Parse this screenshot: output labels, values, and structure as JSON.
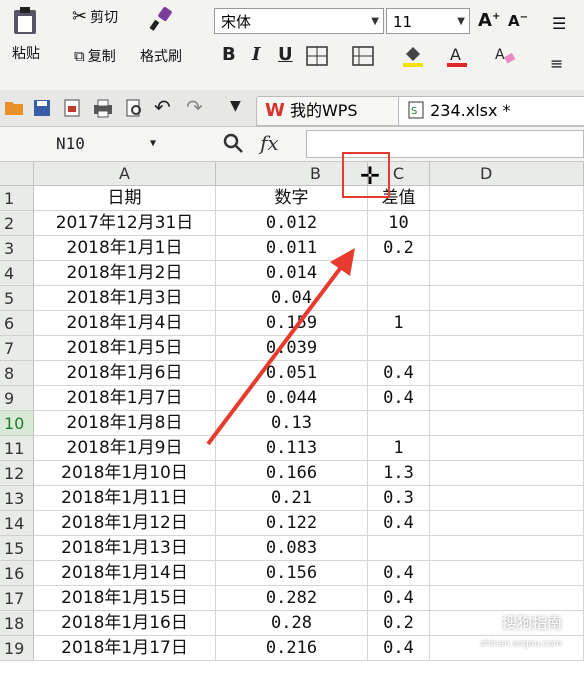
{
  "ribbon": {
    "paste_label": "粘贴",
    "cut_label": "剪切",
    "copy_label": "复制",
    "format_painter_label": "格式刷",
    "font_name": "宋体",
    "font_size": "11",
    "bold": "B",
    "italic": "I",
    "underline": "U"
  },
  "tabs": [
    {
      "label": "我的WPS"
    },
    {
      "label": "234.xlsx *"
    }
  ],
  "formula_bar": {
    "name_box": "N10",
    "fx": "fx"
  },
  "columns": [
    "A",
    "B",
    "C",
    "D"
  ],
  "row_numbers": [
    "1",
    "2",
    "3",
    "4",
    "5",
    "6",
    "7",
    "8",
    "9",
    "10",
    "11",
    "12",
    "13",
    "14",
    "15",
    "16",
    "17",
    "18",
    "19"
  ],
  "rows": [
    {
      "a": "日期",
      "b": "数字",
      "c": "差值"
    },
    {
      "a": "2017年12月31日",
      "b": "0.012",
      "c": "10"
    },
    {
      "a": "2018年1月1日",
      "b": "0.011",
      "c": "0.2"
    },
    {
      "a": "2018年1月2日",
      "b": "0.014",
      "c": ""
    },
    {
      "a": "2018年1月3日",
      "b": "0.04",
      "c": ""
    },
    {
      "a": "2018年1月4日",
      "b": "0.159",
      "c": "1"
    },
    {
      "a": "2018年1月5日",
      "b": "0.039",
      "c": ""
    },
    {
      "a": "2018年1月6日",
      "b": "0.051",
      "c": "0.4"
    },
    {
      "a": "2018年1月7日",
      "b": "0.044",
      "c": "0.4"
    },
    {
      "a": "2018年1月8日",
      "b": "0.13",
      "c": ""
    },
    {
      "a": "2018年1月9日",
      "b": "0.113",
      "c": "1"
    },
    {
      "a": "2018年1月10日",
      "b": "0.166",
      "c": "1.3"
    },
    {
      "a": "2018年1月11日",
      "b": "0.21",
      "c": "0.3"
    },
    {
      "a": "2018年1月12日",
      "b": "0.122",
      "c": "0.4"
    },
    {
      "a": "2018年1月13日",
      "b": "0.083",
      "c": ""
    },
    {
      "a": "2018年1月14日",
      "b": "0.156",
      "c": "0.4"
    },
    {
      "a": "2018年1月15日",
      "b": "0.282",
      "c": "0.4"
    },
    {
      "a": "2018年1月16日",
      "b": "0.28",
      "c": "0.2"
    },
    {
      "a": "2018年1月17日",
      "b": "0.216",
      "c": "0.4"
    }
  ],
  "active_row": "10",
  "watermark": {
    "text": "搜狗指南",
    "sub": "zhinan.sogou.com"
  },
  "colors": {
    "annotation": "#e83b2f",
    "active_row": "#1d7a2a"
  }
}
